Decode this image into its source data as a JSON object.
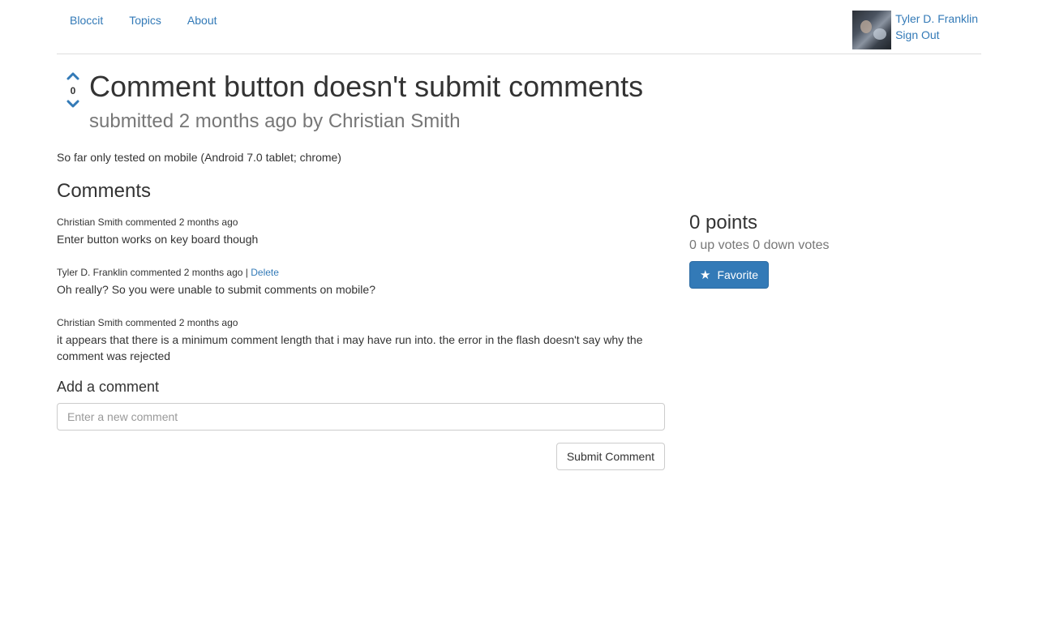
{
  "nav": {
    "links": [
      "Bloccit",
      "Topics",
      "About"
    ],
    "user_name": "Tyler D. Franklin",
    "sign_out": "Sign Out"
  },
  "post": {
    "vote_count": "0",
    "title": "Comment button doesn't submit comments",
    "meta": "submitted 2 months ago by Christian Smith",
    "body": "So far only tested on mobile (Android 7.0 tablet; chrome)"
  },
  "sidebar": {
    "points": "0 points",
    "votes_detail": "0 up votes 0 down votes",
    "favorite_label": "Favorite"
  },
  "comments": {
    "heading": "Comments",
    "items": [
      {
        "meta": "Christian Smith commented 2 months ago",
        "body": "Enter button works on key board though"
      },
      {
        "meta": "Tyler D. Franklin commented 2 months ago |",
        "delete_label": "Delete",
        "body": "Oh really? So you were unable to submit comments on mobile?"
      },
      {
        "meta": "Christian Smith commented 2 months ago",
        "body": "it appears that there is a minimum comment length that i may have run into. the error in the flash doesn't say why the comment was rejected"
      }
    ]
  },
  "add_comment": {
    "heading": "Add a comment",
    "placeholder": "Enter a new comment",
    "submit_label": "Submit Comment"
  },
  "colors": {
    "link": "#337ab7",
    "primary_button": "#337ab7",
    "muted_text": "#777777"
  },
  "icons": [
    "chevron-up-icon",
    "chevron-down-icon",
    "star-icon"
  ]
}
